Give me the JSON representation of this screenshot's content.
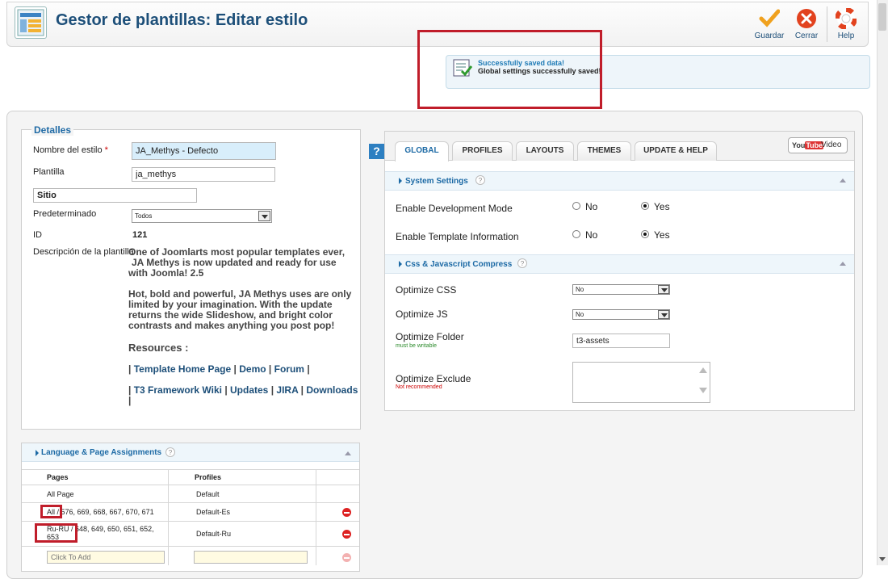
{
  "header": {
    "title": "Gestor de plantillas: Editar estilo",
    "toolbar": {
      "save_label": "Guardar",
      "close_label": "Cerrar",
      "help_label": "Help"
    }
  },
  "message": {
    "title": "Successfully saved data!",
    "body": "Global settings successfully saved!"
  },
  "details": {
    "legend": "Detalles",
    "style_name_label": "Nombre del estilo",
    "style_name_required": "*",
    "style_name_value": "JA_Methys - Defecto",
    "template_label": "Plantilla",
    "template_value": "ja_methys",
    "site_value": "Sitio",
    "default_label": "Predeterminado",
    "default_value": "Todos",
    "id_label": "ID",
    "id_value": "121",
    "description_label": "Descripción de la plantilla",
    "desc_para1_line1": "One of Joomlarts most popular templates ever,",
    "desc_para1_line2": "JA Methys is now updated and ready for use",
    "desc_para1_line3": "with Joomla! 2.5",
    "desc_para2_line1": "Hot, bold and powerful, JA Methys uses are only",
    "desc_para2_line2": "limited by your imagination. With the update",
    "desc_para2_line3": "returns the wide Slideshow, and bright color",
    "desc_para2_line4": "contrasts and makes anything you post pop!",
    "resources_heading": "Resources :",
    "links_row1": {
      "pipe": "|",
      "template_home": "Template Home Page",
      "demo": "Demo",
      "forum": "Forum"
    },
    "links_row2": {
      "t3_wiki": "T3 Framework Wiki",
      "updates": "Updates",
      "jira": "JIRA",
      "downloads": "Downloads"
    }
  },
  "language_panel": {
    "title": "Language & Page Assignments",
    "help": "?",
    "col_pages": "Pages",
    "col_profiles": "Profiles",
    "rows": [
      {
        "page": "All Page",
        "profile": "Default"
      },
      {
        "page": "All / 576, 669, 668, 667, 670, 671",
        "profile": "Default-Es"
      },
      {
        "page_line1": "Ru-RU / 648, 649, 650, 651, 652,",
        "page_line2": "653",
        "profile": "Default-Ru"
      }
    ],
    "add_placeholder": "Click To Add"
  },
  "tabs": {
    "help": "?",
    "items": [
      "GLOBAL",
      "PROFILES",
      "LAYOUTS",
      "THEMES",
      "UPDATE & HELP"
    ],
    "video_logo_you": "You",
    "video_logo_tube": "Tube",
    "video_label": "Video"
  },
  "system_settings": {
    "title": "System Settings",
    "help": "?",
    "dev_mode_label": "Enable Development Mode",
    "template_info_label": "Enable Template Information",
    "no_label": "No",
    "yes_label": "Yes",
    "dev_mode_value": "Yes",
    "template_info_value": "Yes"
  },
  "css_js": {
    "title": "Css & Javascript Compress",
    "help": "?",
    "optimize_css_label": "Optimize CSS",
    "optimize_css_value": "No",
    "optimize_js_label": "Optimize JS",
    "optimize_js_value": "No",
    "optimize_folder_label": "Optimize Folder",
    "optimize_folder_note": "must be writable",
    "optimize_folder_value": "t3-assets",
    "optimize_exclude_label": "Optimize Exclude",
    "optimize_exclude_note": "Not recommended",
    "optimize_exclude_value": ""
  },
  "colors": {
    "title_blue": "#1d4f79",
    "accent_blue": "#1d6aa5",
    "highlight_red": "#c01d2a",
    "note_green": "#2a8a2a",
    "note_red": "#cc0000"
  }
}
